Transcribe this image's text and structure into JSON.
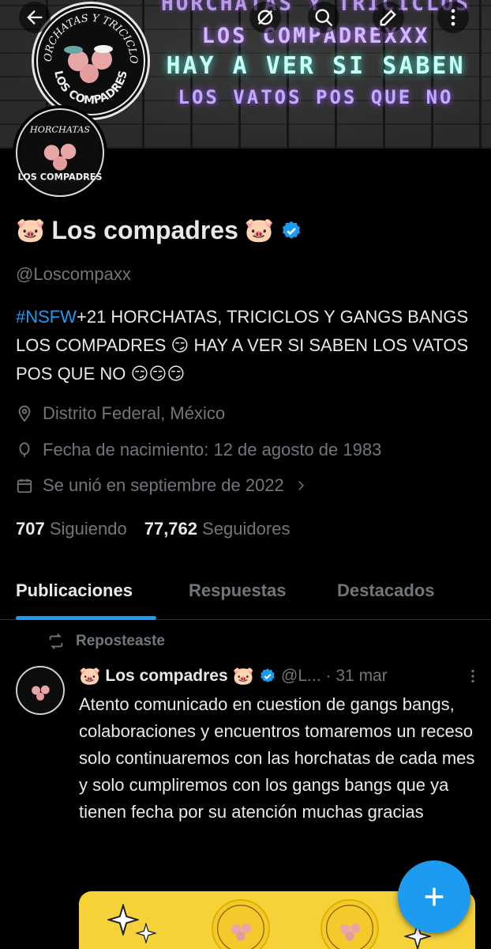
{
  "banner": {
    "neon_lines": [
      "HORCHATAS Y TRICICLOS",
      "LOS COMPADREXXX",
      "HAY A VER SI SABEN",
      "LOS VATOS POS QUE NO"
    ],
    "logo_top_text": "HORCHATAS Y TRICICLOS",
    "logo_bottom_text": "LOS COMPADRES"
  },
  "header_actions": [
    "back-icon",
    "mute-icon",
    "search-icon",
    "edit-icon",
    "more-icon"
  ],
  "profile": {
    "display_name": "Los compadres",
    "handle": "@Loscompaxx",
    "bio_hashtag": "#NSFW",
    "bio_text": "+21 HORCHATAS, TRICICLOS Y GANGS BANGS  LOS COMPADRES 😏 HAY A VER SI SABEN LOS VATOS POS QUE NO 😏😏😏",
    "location": "Distrito Federal, México",
    "birthdate": "Fecha de nacimiento: 12 de agosto de 1983",
    "joined": "Se unió en septiembre de 2022",
    "following_count": "707",
    "following_label": "Siguiendo",
    "followers_count": "77,762",
    "followers_label": "Seguidores"
  },
  "tabs": [
    {
      "label": "Publicaciones",
      "active": true
    },
    {
      "label": "Respuestas",
      "active": false
    },
    {
      "label": "Destacados",
      "active": false
    }
  ],
  "post": {
    "repost_label": "Reposteaste",
    "author_name": "Los compadres",
    "author_handle": "@L...",
    "date": "· 31 mar",
    "text": "Atento comunicado en cuestion de gangs bangs, colaboraciones y encuentros tomaremos un receso solo continuaremos con las horchatas de cada mes y solo cumpliremos con los gangs bangs que ya tienen fecha por su atención muchas gracias"
  },
  "colors": {
    "accent": "#1d9bf0",
    "text": "#e7e9ea",
    "muted": "#71767b",
    "background": "#000000"
  }
}
